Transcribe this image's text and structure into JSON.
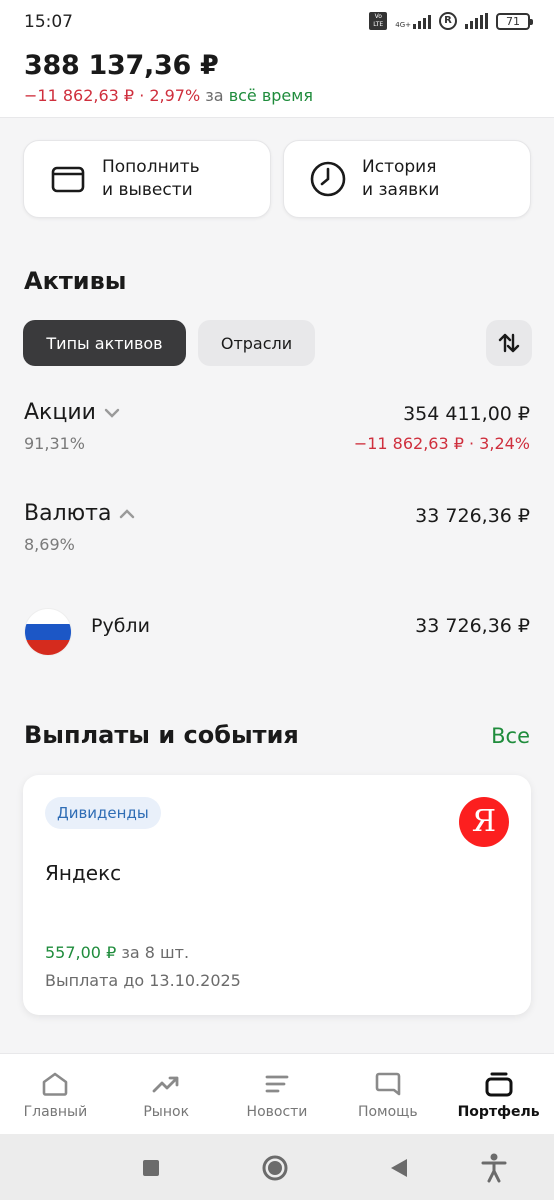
{
  "status_bar": {
    "time": "15:07",
    "network": "4G+",
    "volte": "Vo LTE",
    "battery": "71",
    "icons": [
      "volte-icon",
      "signal-icon",
      "registered-icon",
      "signal-icon",
      "battery-icon"
    ]
  },
  "header": {
    "total": "388 137,36 ₽",
    "change_value": "−11 862,63 ₽ · 2,97%",
    "change_prefix": "за",
    "change_period": "всё время"
  },
  "actions": [
    {
      "label": "Пополнить\nи вывести",
      "icon": "wallet-icon"
    },
    {
      "label": "История\nи заявки",
      "icon": "clock-icon"
    }
  ],
  "assets": {
    "title": "Активы",
    "tabs": [
      {
        "label": "Типы активов",
        "active": true
      },
      {
        "label": "Отрасли",
        "active": false
      }
    ],
    "sort_icon": "sort-icon",
    "groups": [
      {
        "name": "Акции",
        "share": "91,31%",
        "value": "354 411,00 ₽",
        "change": "−11 862,63 ₽ · 3,24%",
        "expanded": false
      },
      {
        "name": "Валюта",
        "share": "8,69%",
        "value": "33 726,36 ₽",
        "expanded": true,
        "items": [
          {
            "name": "Рубли",
            "value": "33 726,36 ₽",
            "icon": "russia-flag-icon"
          }
        ]
      }
    ]
  },
  "events": {
    "title": "Выплаты и события",
    "all_link": "Все",
    "card": {
      "badge": "Дивиденды",
      "logo_letter": "Я",
      "company": "Яндекс",
      "amount": "557,00 ₽",
      "amount_suffix": "за 8 шт.",
      "payout": "Выплата до 13.10.2025"
    }
  },
  "bottom_nav": [
    {
      "label": "Главный",
      "icon": "home-icon",
      "active": false
    },
    {
      "label": "Рынок",
      "icon": "trend-icon",
      "active": false
    },
    {
      "label": "Новости",
      "icon": "news-icon",
      "active": false
    },
    {
      "label": "Помощь",
      "icon": "chat-icon",
      "active": false
    },
    {
      "label": "Портфель",
      "icon": "briefcase-icon",
      "active": true
    }
  ],
  "colors": {
    "negative": "#cf2f3d",
    "positive": "#1f8c3c",
    "chip_active": "#3a3a3c",
    "badge_text": "#2f6db5",
    "yandex_red": "#fc1f1f"
  }
}
